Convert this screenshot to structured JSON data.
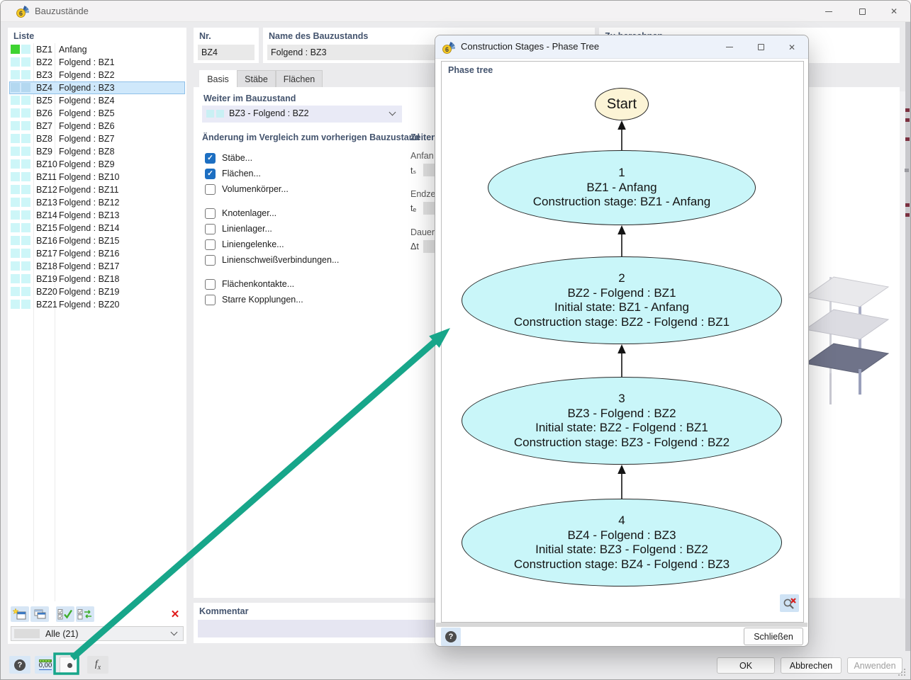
{
  "colors": {
    "accent_teal": "#17A68A",
    "header_text": "#44546E",
    "row_cyan": "#CDF6F8",
    "row_green": "#3ED331",
    "selection_bg": "#CFE8FB",
    "checkbox_checked": "#1D6FC2",
    "node_fill": "#C9F6F9",
    "start_node_fill": "#FCF4D6",
    "delete_red": "#E01B1B"
  },
  "window": {
    "title": "Bauzustände"
  },
  "liste": {
    "header": "Liste",
    "filter_value": "Alle (21)",
    "rows": [
      {
        "id": "BZ1",
        "name": "Anfang",
        "marker": "green",
        "selected": false
      },
      {
        "id": "BZ2",
        "name": "Folgend : BZ1",
        "marker": "cyan",
        "selected": false
      },
      {
        "id": "BZ3",
        "name": "Folgend : BZ2",
        "marker": "cyan",
        "selected": false
      },
      {
        "id": "BZ4",
        "name": "Folgend : BZ3",
        "marker": "cyan",
        "selected": true
      },
      {
        "id": "BZ5",
        "name": "Folgend : BZ4",
        "marker": "cyan",
        "selected": false
      },
      {
        "id": "BZ6",
        "name": "Folgend : BZ5",
        "marker": "cyan",
        "selected": false
      },
      {
        "id": "BZ7",
        "name": "Folgend : BZ6",
        "marker": "cyan",
        "selected": false
      },
      {
        "id": "BZ8",
        "name": "Folgend : BZ7",
        "marker": "cyan",
        "selected": false
      },
      {
        "id": "BZ9",
        "name": "Folgend : BZ8",
        "marker": "cyan",
        "selected": false
      },
      {
        "id": "BZ10",
        "name": "Folgend : BZ9",
        "marker": "cyan",
        "selected": false
      },
      {
        "id": "BZ11",
        "name": "Folgend : BZ10",
        "marker": "cyan",
        "selected": false
      },
      {
        "id": "BZ12",
        "name": "Folgend : BZ11",
        "marker": "cyan",
        "selected": false
      },
      {
        "id": "BZ13",
        "name": "Folgend : BZ12",
        "marker": "cyan",
        "selected": false
      },
      {
        "id": "BZ14",
        "name": "Folgend : BZ13",
        "marker": "cyan",
        "selected": false
      },
      {
        "id": "BZ15",
        "name": "Folgend : BZ14",
        "marker": "cyan",
        "selected": false
      },
      {
        "id": "BZ16",
        "name": "Folgend : BZ15",
        "marker": "cyan",
        "selected": false
      },
      {
        "id": "BZ17",
        "name": "Folgend : BZ16",
        "marker": "cyan",
        "selected": false
      },
      {
        "id": "BZ18",
        "name": "Folgend : BZ17",
        "marker": "cyan",
        "selected": false
      },
      {
        "id": "BZ19",
        "name": "Folgend : BZ18",
        "marker": "cyan",
        "selected": false
      },
      {
        "id": "BZ20",
        "name": "Folgend : BZ19",
        "marker": "cyan",
        "selected": false
      },
      {
        "id": "BZ21",
        "name": "Folgend : BZ20",
        "marker": "cyan",
        "selected": false
      }
    ]
  },
  "details": {
    "nr_label": "Nr.",
    "nr_value": "BZ4",
    "name_label": "Name des Bauzustands",
    "name_value": "Folgend : BZ3",
    "tabs": [
      {
        "label": "Basis",
        "active": true
      },
      {
        "label": "Stäbe",
        "active": false
      },
      {
        "label": "Flächen",
        "active": false
      }
    ],
    "weiter_label": "Weiter im Bauzustand",
    "weiter_value": "BZ3 - Folgend : BZ2",
    "aenderung_label": "Änderung im Vergleich zum vorherigen Bauzustand",
    "checkboxes": [
      {
        "label": "Stäbe...",
        "checked": true
      },
      {
        "label": "Flächen...",
        "checked": true
      },
      {
        "label": "Volumenkörper...",
        "checked": false
      },
      {
        "label": "Knotenlager...",
        "checked": false,
        "gap": true
      },
      {
        "label": "Linienlager...",
        "checked": false
      },
      {
        "label": "Liniengelenke...",
        "checked": false
      },
      {
        "label": "Linienschweißverbindungen...",
        "checked": false
      },
      {
        "label": "Flächenkontakte...",
        "checked": false,
        "gap": true
      },
      {
        "label": "Starre Kopplungen...",
        "checked": false
      }
    ],
    "zeiten": {
      "header": "Zeiten",
      "rows": [
        {
          "label": "Anfan",
          "symbol": "tₛ"
        },
        {
          "label": "Endze",
          "symbol": "tₑ"
        },
        {
          "label": "Dauer",
          "symbol": "Δt"
        }
      ]
    },
    "zu_berechnen_label": "Zu berechnen",
    "kommentar_label": "Kommentar"
  },
  "footer": {
    "decimals_label": "0,00",
    "ok": "OK",
    "cancel": "Abbrechen",
    "apply": "Anwenden"
  },
  "phase_dialog": {
    "title": "Construction Stages - Phase Tree",
    "panel_label": "Phase tree",
    "close_button": "Schließen",
    "nodes": [
      {
        "type": "start",
        "lines": [
          "Start"
        ]
      },
      {
        "type": "stage",
        "lines": [
          "1",
          "BZ1 - Anfang",
          "Construction stage: BZ1 - Anfang"
        ]
      },
      {
        "type": "stage",
        "lines": [
          "2",
          "BZ2 - Folgend : BZ1",
          "Initial state: BZ1 - Anfang",
          "Construction stage: BZ2 - Folgend : BZ1"
        ]
      },
      {
        "type": "stage",
        "lines": [
          "3",
          "BZ3 - Folgend : BZ2",
          "Initial state: BZ2 - Folgend : BZ1",
          "Construction stage: BZ3 - Folgend : BZ2"
        ]
      },
      {
        "type": "stage",
        "lines": [
          "4",
          "BZ4 - Folgend : BZ3",
          "Initial state: BZ3 - Folgend : BZ2",
          "Construction stage: BZ4 - Folgend : BZ3"
        ]
      }
    ]
  }
}
